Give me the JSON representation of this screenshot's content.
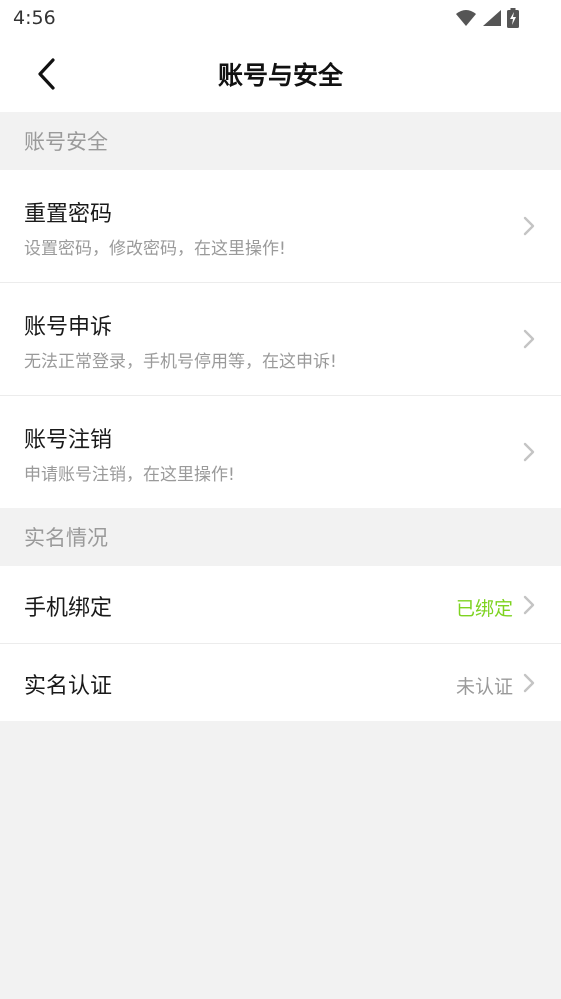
{
  "status_bar": {
    "time": "4:56",
    "icons": [
      "wifi-icon",
      "signal-icon",
      "battery-charging-icon"
    ]
  },
  "header": {
    "title": "账号与安全",
    "back_icon": "chevron-left-icon"
  },
  "sections": [
    {
      "header": "账号安全",
      "items": [
        {
          "title": "重置密码",
          "description": "设置密码，修改密码，在这里操作!"
        },
        {
          "title": "账号申诉",
          "description": "无法正常登录，手机号停用等，在这申诉!"
        },
        {
          "title": "账号注销",
          "description": "申请账号注销，在这里操作!"
        }
      ]
    },
    {
      "header": "实名情况",
      "items": [
        {
          "title": "手机绑定",
          "value": "已绑定",
          "value_color": "#7ed321"
        },
        {
          "title": "实名认证",
          "value": "未认证",
          "value_color": "#9a9a9a"
        }
      ]
    }
  ],
  "colors": {
    "page_background": "#f2f2f2",
    "card_background": "#ffffff",
    "muted_text": "#9a9a9a",
    "chevron": "#c4c4c4",
    "bound_green": "#7ed321"
  }
}
